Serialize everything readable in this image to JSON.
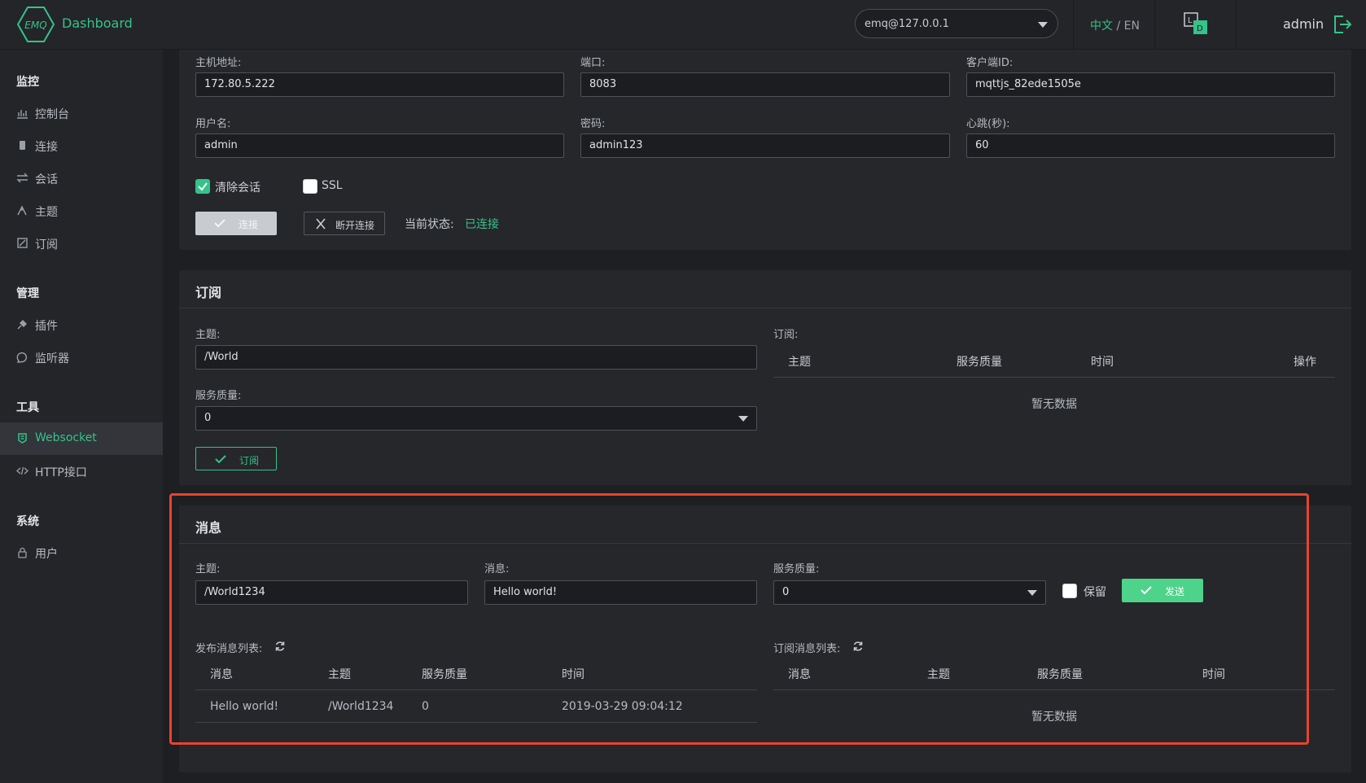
{
  "header": {
    "brand": "Dashboard",
    "logo_text": "EMQ",
    "node": "emq@127.0.0.1",
    "lang_zh": "中文",
    "lang_sep": "/",
    "lang_en": "EN",
    "user": "admin"
  },
  "sidebar": {
    "groups": [
      {
        "title": "监控",
        "items": [
          "控制台",
          "连接",
          "会话",
          "主题",
          "订阅"
        ]
      },
      {
        "title": "管理",
        "items": [
          "插件",
          "监听器"
        ]
      },
      {
        "title": "工具",
        "items": [
          "Websocket",
          "HTTP接口"
        ]
      },
      {
        "title": "系统",
        "items": [
          "用户"
        ]
      }
    ],
    "active": "Websocket"
  },
  "connection": {
    "host_label": "主机地址:",
    "host": "172.80.5.222",
    "port_label": "端口:",
    "port": "8083",
    "client_label": "客户端ID:",
    "client_id": "mqttjs_82ede1505e",
    "user_label": "用户名:",
    "username": "admin",
    "pass_label": "密码:",
    "password": "admin123",
    "keepalive_label": "心跳(秒):",
    "keepalive": "60",
    "clean_session": "清除会话",
    "ssl": "SSL",
    "connect_btn": "连接",
    "disconnect_btn": "断开连接",
    "status_label": "当前状态:",
    "status": "已连接"
  },
  "subscribe": {
    "title": "订阅",
    "topic_label": "主题:",
    "topic": "/World",
    "qos_label": "服务质量:",
    "qos": "0",
    "btn": "订阅",
    "list_label": "订阅:",
    "columns": [
      "主题",
      "服务质量",
      "时间",
      "操作"
    ],
    "empty": "暂无数据"
  },
  "message": {
    "title": "消息",
    "topic_label": "主题:",
    "topic": "/World1234",
    "msg_label": "消息:",
    "msg": "Hello world!",
    "qos_label": "服务质量:",
    "qos": "0",
    "retain": "保留",
    "send_btn": "发送",
    "pub_list_label": "发布消息列表:",
    "pub_columns": [
      "消息",
      "主题",
      "服务质量",
      "时间"
    ],
    "pub_rows": [
      {
        "msg": "Hello world!",
        "topic": "/World1234",
        "qos": "0",
        "time": "2019-03-29 09:04:12"
      }
    ],
    "sub_list_label": "订阅消息列表:",
    "sub_columns": [
      "消息",
      "主题",
      "服务质量",
      "时间"
    ],
    "empty": "暂无数据"
  },
  "colors": {
    "accent": "#34c388",
    "highlight": "#e8432f"
  }
}
